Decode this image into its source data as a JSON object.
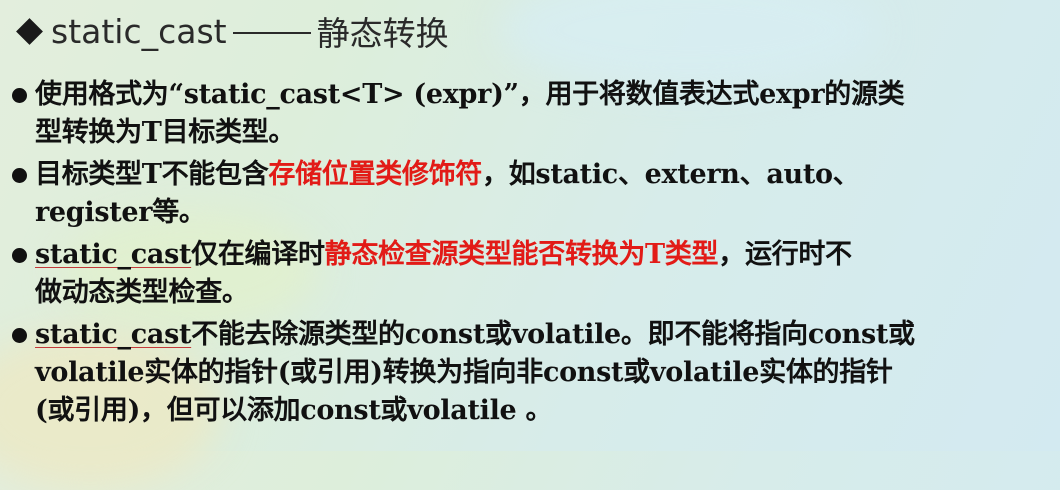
{
  "slide": {
    "title": {
      "code": "static_cast",
      "text": "静态转换"
    },
    "bullets": [
      {
        "lines": [
          [
            "使用格式为“static_cast<T> (expr)”，用于将数值表达式expr的源类"
          ],
          [
            "型转换为T目标类型。"
          ]
        ]
      },
      {
        "lines": [
          [
            "目标类型T不能包含",
            "存储位置类修饰符",
            "，如static、extern、auto、"
          ],
          [
            "register等。"
          ]
        ]
      },
      {
        "lines": [
          [
            "static_cast",
            "仅在编译时",
            "静态检查源类型能否转换为T类型",
            "，运行时不"
          ],
          [
            "做动态类型检查。"
          ]
        ]
      },
      {
        "lines": [
          [
            "static_cast",
            "不能去除源类型的const或volatile。即不能将指向const或"
          ],
          [
            "volatile实体的指针(或引用)转换为指向非const或volatile实体的指针"
          ],
          [
            "(或引用)，但可以添加const或volatile 。"
          ]
        ]
      }
    ]
  },
  "colors": {
    "emphasis": "#e21b17",
    "text": "#111111",
    "background": "#d9ede4"
  }
}
